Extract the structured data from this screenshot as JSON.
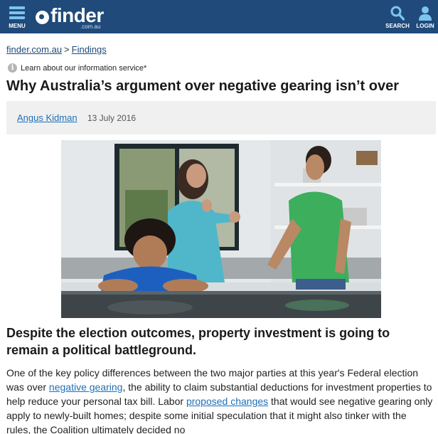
{
  "header": {
    "menu_label": "MENU",
    "logo_text": "finder",
    "logo_sub": ".com.au",
    "search_label": "SEARCH",
    "login_label": "LOGIN",
    "bg_color": "#1f4a7a",
    "accent_color": "#7ec3f0"
  },
  "breadcrumb": {
    "home": "finder.com.au",
    "separator": ">",
    "section": "Findings"
  },
  "info_link": "Learn about our information service*",
  "article": {
    "title": "Why Australia’s argument over negative gearing isn’t over",
    "author": "Angus Kidman",
    "date": "13 July 2016",
    "subhead": "Despite the election outcomes, property investment is going to remain a political battleground.",
    "body": {
      "p1_a": "One of the key policy differences between the two major parties at this year's Federal election was over ",
      "link1": "negative gearing",
      "p1_b": ", the ability to claim substantial deductions for investment properties to help reduce your personal tax bill. Labor ",
      "link2": "proposed changes",
      "p1_c": " that would see negative gearing only apply to newly-built homes; despite some initial speculation that it might also tinker with the rules, the Coalition ultimately decided no"
    }
  }
}
